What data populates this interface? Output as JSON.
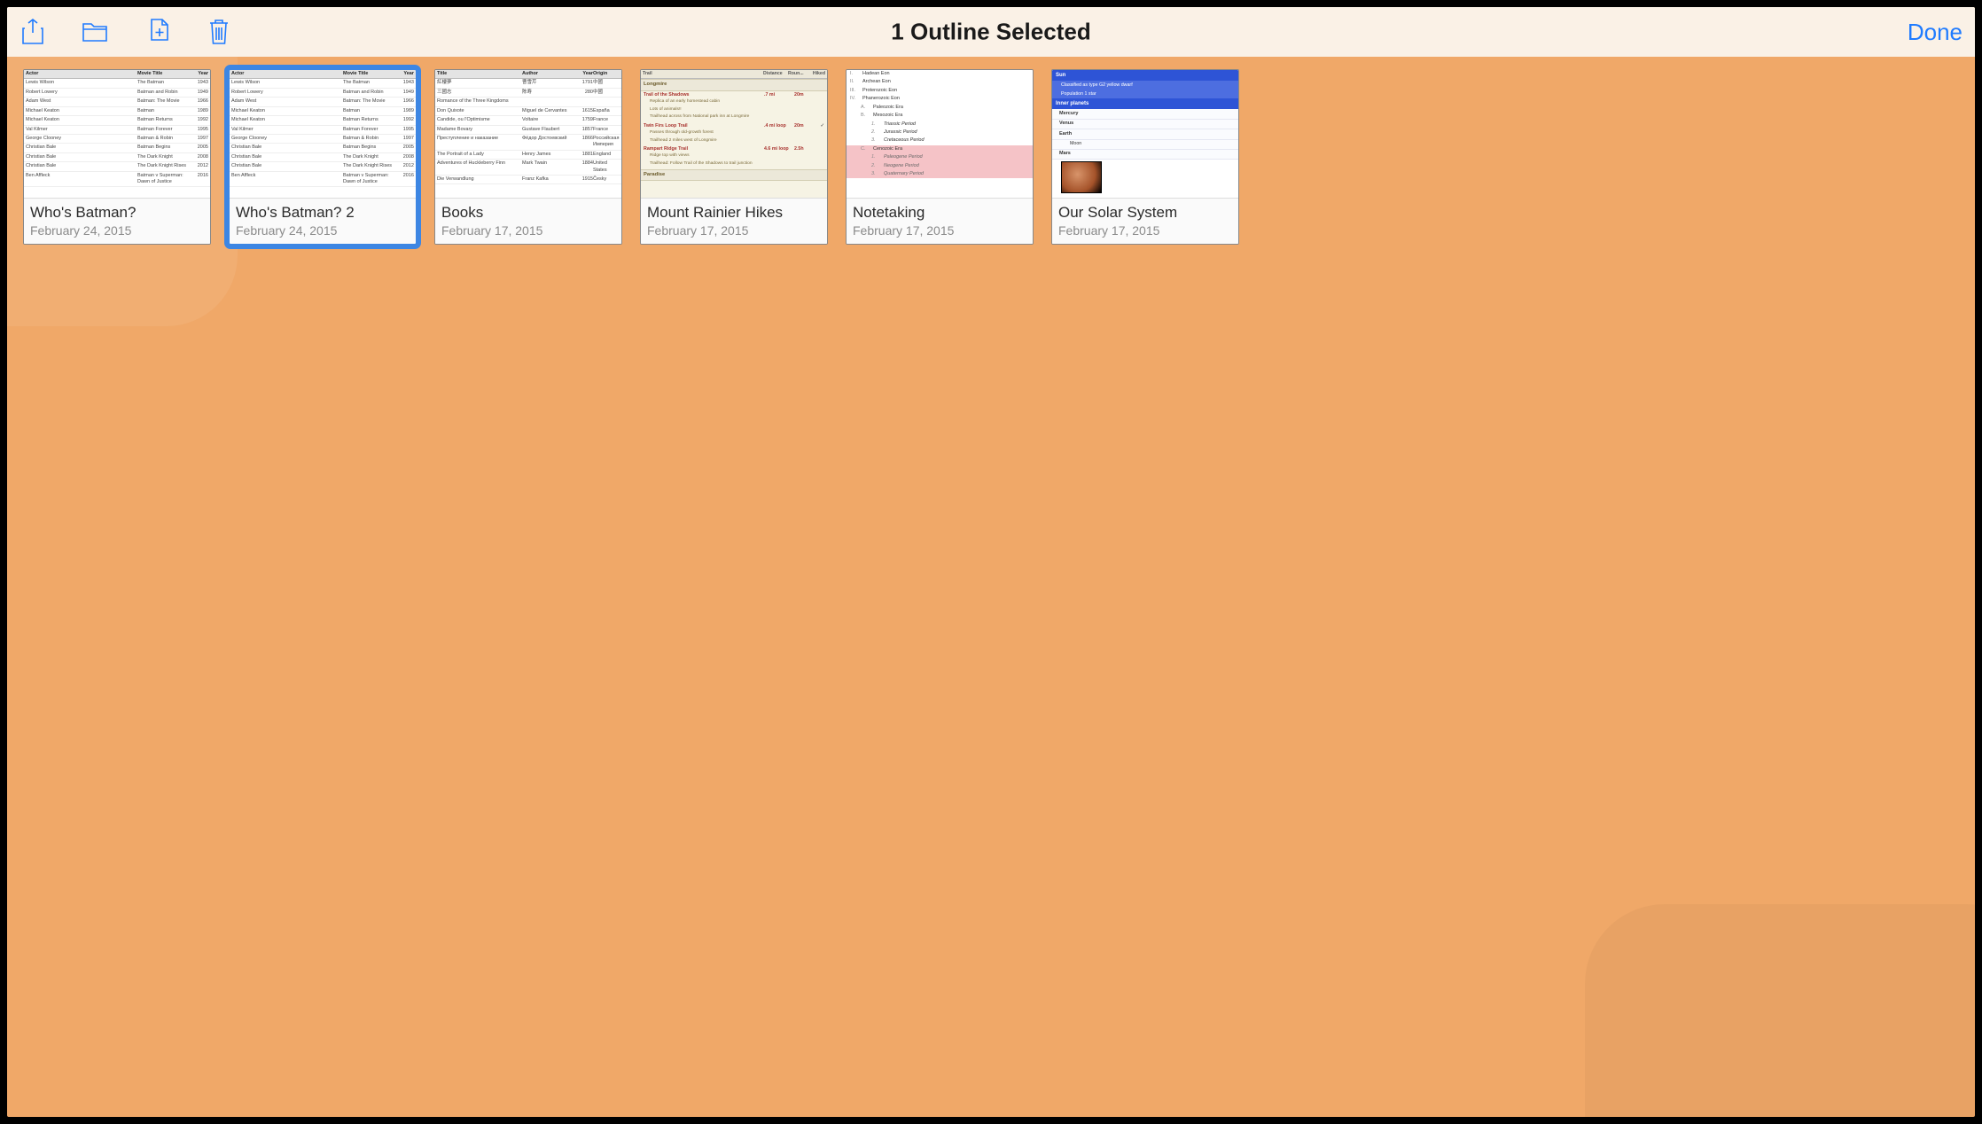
{
  "toolbar": {
    "title": "1 Outline Selected",
    "done_label": "Done",
    "icons": [
      "share-icon",
      "folder-icon",
      "duplicate-icon",
      "trash-icon"
    ]
  },
  "documents": [
    {
      "name": "Who's Batman?",
      "date": "February 24, 2015",
      "thumb": "batman",
      "selected": false
    },
    {
      "name": "Who's Batman? 2",
      "date": "February 24, 2015",
      "thumb": "batman",
      "selected": true
    },
    {
      "name": "Books",
      "date": "February 17, 2015",
      "thumb": "books",
      "selected": false
    },
    {
      "name": "Mount Rainier Hikes",
      "date": "February 17, 2015",
      "thumb": "hikes",
      "selected": false
    },
    {
      "name": "Notetaking",
      "date": "February 17, 2015",
      "thumb": "notes",
      "selected": false
    },
    {
      "name": "Our Solar System",
      "date": "February 17, 2015",
      "thumb": "solar",
      "selected": false
    }
  ],
  "thumbs": {
    "batman": {
      "headers": [
        "Actor",
        "Movie Title",
        "Year"
      ],
      "rows": [
        [
          "Lewis Wilson",
          "The Batman",
          "1943"
        ],
        [
          "Robert Lowery",
          "Batman and Robin",
          "1949"
        ],
        [
          "Adam West",
          "Batman: The Movie",
          "1966"
        ],
        [
          "Michael Keaton",
          "Batman",
          "1989"
        ],
        [
          "Michael Keaton",
          "Batman Returns",
          "1992"
        ],
        [
          "Val Kilmer",
          "Batman Forever",
          "1995"
        ],
        [
          "George Clooney",
          "Batman & Robin",
          "1997"
        ],
        [
          "Christian Bale",
          "Batman Begins",
          "2005"
        ],
        [
          "Christian Bale",
          "The Dark Knight",
          "2008"
        ],
        [
          "Christian Bale",
          "The Dark Knight Rises",
          "2012"
        ],
        [
          "Ben Affleck",
          "Batman v Superman: Dawn of Justice",
          "2016"
        ]
      ]
    },
    "books": {
      "headers": [
        "Title",
        "Author",
        "Year",
        "Origin"
      ],
      "rows": [
        [
          "紅樓夢",
          "曹雪芹",
          "1791",
          "中國"
        ],
        [
          "三國志",
          "陈寿",
          "280",
          "中國"
        ],
        [
          "Romance of the Three Kingdoms",
          "",
          "",
          ""
        ],
        [
          "Don Quixote",
          "Miguel de Cervantes",
          "1615",
          "España"
        ],
        [
          "Candide, ou l'Optimisme",
          "Voltaire",
          "1759",
          "France"
        ],
        [
          "Madame Bovary",
          "Gustave Flaubert",
          "1857",
          "France"
        ],
        [
          "Преступление и наказание",
          "Фёдор Достоевский",
          "1866",
          "Российская Империя"
        ],
        [
          "The Portrait of a Lady",
          "Henry James",
          "1881",
          "England"
        ],
        [
          "Adventures of Huckleberry Finn",
          "Mark Twain",
          "1884",
          "United States"
        ],
        [
          "Die Verwandlung",
          "Franz Kafka",
          "1915",
          "Česky"
        ]
      ]
    },
    "hikes": {
      "headers": [
        "Trail",
        "Distance",
        "Roun...",
        "Hiked"
      ],
      "sections": [
        {
          "name": "Longmire",
          "trails": [
            {
              "name": "Trail of the Shadows",
              "dist": ".7 mi",
              "rt": "20m",
              "ck": "",
              "subs": [
                "Replica of an early homestead cabin",
                "Lots of animals!!",
                "Trailhead across from National park inn at Longmire"
              ]
            },
            {
              "name": "Twin Firs Loop Trail",
              "dist": ".4 mi loop",
              "rt": "20m",
              "ck": "✓",
              "subs": [
                "Passes through old-growth forest",
                "Trailhead 2 miles west of Longmire"
              ]
            },
            {
              "name": "Rampart Ridge Trail",
              "dist": "4.6 mi loop",
              "rt": "2.5h",
              "ck": "",
              "subs": [
                "Ridge top with views",
                "Trailhead: Follow Trail of the Shadows to trail junction"
              ]
            }
          ]
        },
        {
          "name": "Paradise",
          "trails": []
        }
      ]
    },
    "notes": {
      "items": [
        {
          "lvl": 0,
          "num": "I.",
          "text": "Hadean Eon"
        },
        {
          "lvl": 0,
          "num": "II.",
          "text": "Archean Eon"
        },
        {
          "lvl": 0,
          "num": "III.",
          "text": "Proterozoic Eon"
        },
        {
          "lvl": 0,
          "num": "IV.",
          "text": "Phanerozoic Eon"
        },
        {
          "lvl": 1,
          "num": "A.",
          "text": "Paleozoic Era"
        },
        {
          "lvl": 1,
          "num": "B.",
          "text": "Mesozoic Era"
        },
        {
          "lvl": 2,
          "num": "1.",
          "text": "Triassic Period"
        },
        {
          "lvl": 2,
          "num": "2.",
          "text": "Jurassic Period"
        },
        {
          "lvl": 2,
          "num": "3.",
          "text": "Cretaceous Period"
        },
        {
          "lvl": 1,
          "num": "C.",
          "text": "Cenozoic Era",
          "pink": true
        },
        {
          "lvl": 2,
          "num": "1.",
          "text": "Paleogene Period",
          "pink": true,
          "ital": true
        },
        {
          "lvl": 2,
          "num": "2.",
          "text": "Neogene Period",
          "pink": true,
          "ital": true
        },
        {
          "lvl": 2,
          "num": "3.",
          "text": "Quaternary Period",
          "pink": true,
          "ital": true
        }
      ]
    },
    "solar": {
      "lines": [
        {
          "cls": "ss-h",
          "text": "Sun"
        },
        {
          "cls": "ss-sub",
          "text": "Classified as type G2 yellow dwarf"
        },
        {
          "cls": "ss-sub",
          "text": "Population 1 star"
        },
        {
          "cls": "ss-h",
          "text": "Inner planets"
        },
        {
          "cls": "ss-r",
          "text": "Mercury"
        },
        {
          "cls": "ss-r",
          "text": "Venus"
        },
        {
          "cls": "ss-r",
          "text": "Earth"
        },
        {
          "cls": "ss-rm",
          "text": "Moon"
        },
        {
          "cls": "ss-r",
          "text": "Mars"
        },
        {
          "cls": "img"
        }
      ]
    }
  }
}
